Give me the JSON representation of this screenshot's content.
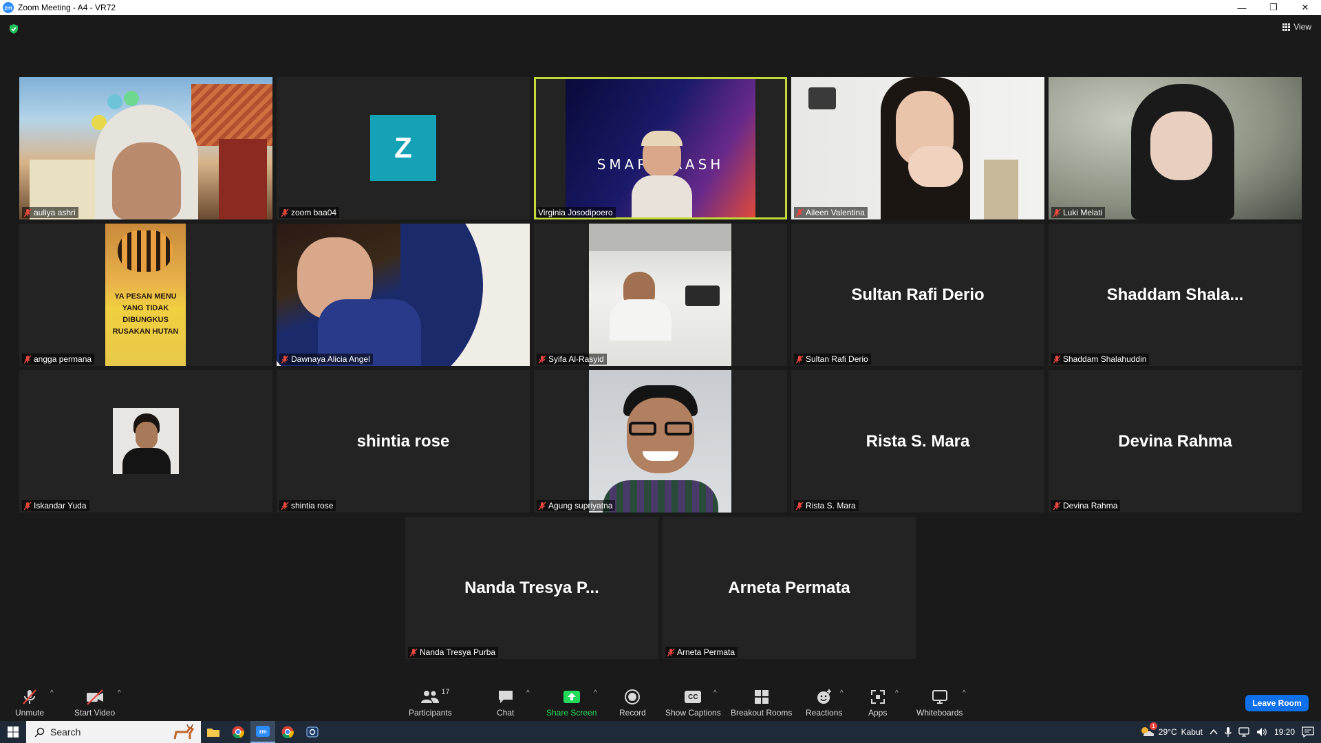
{
  "window": {
    "app_badge": "zm",
    "title": "Zoom Meeting - A4 - VR72",
    "controls": [
      "—",
      "❐",
      "✕"
    ]
  },
  "meeting": {
    "view_label": "View",
    "active_speaker": "Virginia Josodipoero",
    "avatar_letter": "Z",
    "tiles": [
      {
        "name": "auliya ashri",
        "display": ""
      },
      {
        "name": "zoom baa04",
        "display": ""
      },
      {
        "name": "Virginia Josodipoero",
        "display": ""
      },
      {
        "name": "Aileen Valentina",
        "display": ""
      },
      {
        "name": "Luki Melati",
        "display": ""
      },
      {
        "name": "angga permana",
        "display": ""
      },
      {
        "name": "Dawnaya Alicia Angel",
        "display": ""
      },
      {
        "name": "Syifa Al-Rasyid",
        "display": ""
      },
      {
        "name": "Sultan Rafi Derio",
        "display": "Sultan Rafi Derio"
      },
      {
        "name": "Shaddam Shalahuddin",
        "display": "Shaddam  Shala..."
      },
      {
        "name": "Iskandar Yuda",
        "display": ""
      },
      {
        "name": "shintia rose",
        "display": "shintia rose"
      },
      {
        "name": "Agung supriyatna",
        "display": ""
      },
      {
        "name": "Rista S. Mara",
        "display": "Rista S. Mara"
      },
      {
        "name": "Devina Rahma",
        "display": "Devina Rahma"
      },
      {
        "name": "Nanda Tresya Purba",
        "display": "Nanda  Tresya  P..."
      },
      {
        "name": "Arneta Permata",
        "display": "Arneta Permata"
      }
    ],
    "smart_trash_text": "SMARTTRASH",
    "sign_text": [
      "YA PESAN MENU",
      "YANG TIDAK",
      "DIBUNGKUS",
      "RUSAKAN HUTAN"
    ]
  },
  "toolbar": {
    "unmute": "Unmute",
    "start_video": "Start Video",
    "participants": "Participants",
    "participants_count": "17",
    "chat": "Chat",
    "share_screen": "Share Screen",
    "record": "Record",
    "show_captions": "Show Captions",
    "captions_icon_text": "CC",
    "breakout_rooms": "Breakout Rooms",
    "reactions": "Reactions",
    "apps": "Apps",
    "whiteboards": "Whiteboards",
    "leave_room": "Leave Room"
  },
  "taskbar": {
    "search_placeholder": "Search",
    "temperature": "29°C",
    "weather": "Kabut",
    "time": "19:20",
    "zoom_app_label": "zm",
    "weather_badge": "1"
  },
  "colors": {
    "active_border": "#c4d93a",
    "avatar_bg": "#16a2b6",
    "share_green": "#23d959",
    "leave_blue": "#0e71eb",
    "muted_red": "#e8483f"
  }
}
